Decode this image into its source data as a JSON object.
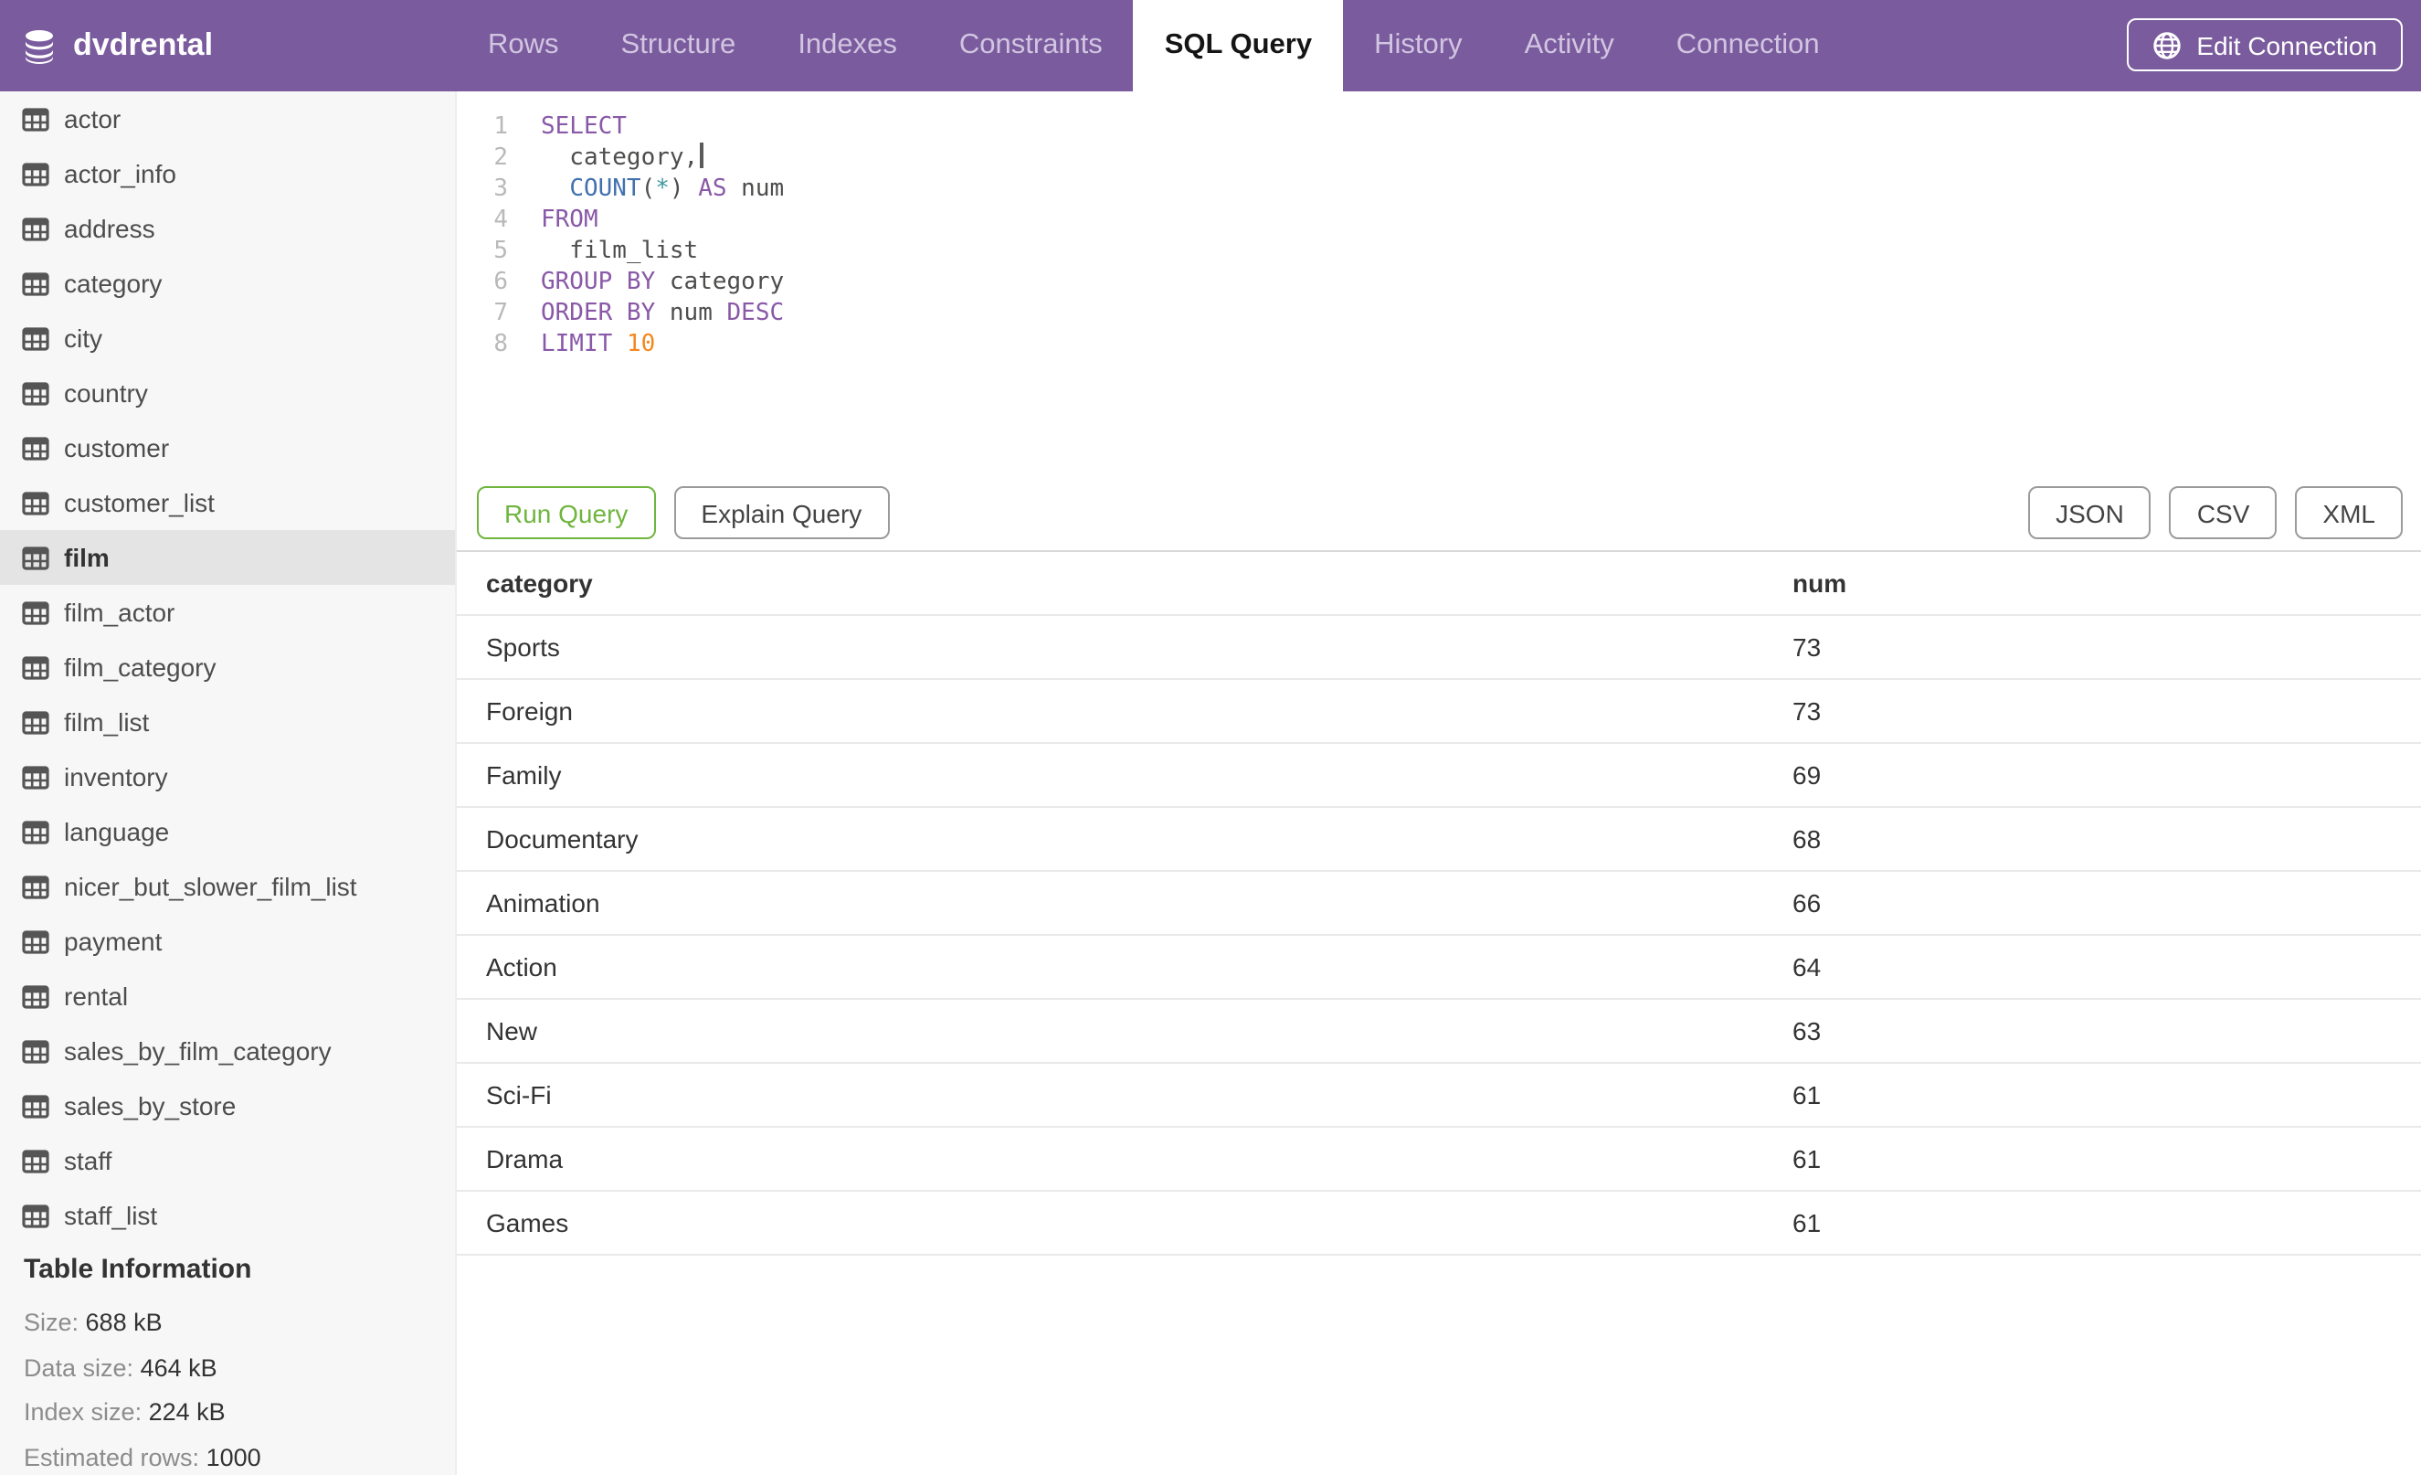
{
  "header": {
    "database": "dvdrental",
    "tabs": [
      "Rows",
      "Structure",
      "Indexes",
      "Constraints",
      "SQL Query",
      "History",
      "Activity",
      "Connection"
    ],
    "active_tab": "SQL Query",
    "edit_connection_label": "Edit Connection"
  },
  "sidebar": {
    "tables": [
      "actor",
      "actor_info",
      "address",
      "category",
      "city",
      "country",
      "customer",
      "customer_list",
      "film",
      "film_actor",
      "film_category",
      "film_list",
      "inventory",
      "language",
      "nicer_but_slower_film_list",
      "payment",
      "rental",
      "sales_by_film_category",
      "sales_by_store",
      "staff",
      "staff_list"
    ],
    "selected_table": "film",
    "info": {
      "title": "Table Information",
      "rows": [
        {
          "label": "Size:",
          "value": "688 kB"
        },
        {
          "label": "Data size:",
          "value": "464 kB"
        },
        {
          "label": "Index size:",
          "value": "224 kB"
        },
        {
          "label": "Estimated rows:",
          "value": "1000"
        }
      ]
    }
  },
  "editor": {
    "line_numbers": [
      "1",
      "2",
      "3",
      "4",
      "5",
      "6",
      "7",
      "8"
    ],
    "lines": [
      [
        {
          "t": "SELECT",
          "c": "kw"
        }
      ],
      [
        {
          "t": "  category,",
          "c": "plain"
        },
        {
          "cursor": true
        }
      ],
      [
        {
          "t": "  ",
          "c": "plain"
        },
        {
          "t": "COUNT",
          "c": "fn"
        },
        {
          "t": "(",
          "c": "plain"
        },
        {
          "t": "*",
          "c": "op"
        },
        {
          "t": ")",
          "c": "plain"
        },
        {
          "t": " ",
          "c": "plain"
        },
        {
          "t": "AS",
          "c": "kw"
        },
        {
          "t": " num",
          "c": "plain"
        }
      ],
      [
        {
          "t": "FROM",
          "c": "kw"
        }
      ],
      [
        {
          "t": "  film_list",
          "c": "plain"
        }
      ],
      [
        {
          "t": "GROUP BY",
          "c": "kw"
        },
        {
          "t": " category",
          "c": "plain"
        }
      ],
      [
        {
          "t": "ORDER BY",
          "c": "kw"
        },
        {
          "t": " num ",
          "c": "plain"
        },
        {
          "t": "DESC",
          "c": "kw"
        }
      ],
      [
        {
          "t": "LIMIT",
          "c": "kw"
        },
        {
          "t": " ",
          "c": "plain"
        },
        {
          "t": "10",
          "c": "num"
        }
      ]
    ]
  },
  "toolbar": {
    "run_label": "Run Query",
    "explain_label": "Explain Query",
    "export_buttons": [
      "JSON",
      "CSV",
      "XML"
    ]
  },
  "results": {
    "columns": [
      "category",
      "num"
    ],
    "rows": [
      [
        "Sports",
        "73"
      ],
      [
        "Foreign",
        "73"
      ],
      [
        "Family",
        "69"
      ],
      [
        "Documentary",
        "68"
      ],
      [
        "Animation",
        "66"
      ],
      [
        "Action",
        "64"
      ],
      [
        "New",
        "63"
      ],
      [
        "Sci-Fi",
        "61"
      ],
      [
        "Drama",
        "61"
      ],
      [
        "Games",
        "61"
      ]
    ]
  },
  "colors": {
    "header_purple": "#7a5c9e",
    "run_green": "#6fb53e",
    "selected_item_bg": "#e4e4e4",
    "sql_keyword": "#8959a8",
    "sql_function": "#4271ae",
    "sql_operator": "#3e999f",
    "sql_number": "#f5871f",
    "sql_text": "#4d4d4c"
  }
}
